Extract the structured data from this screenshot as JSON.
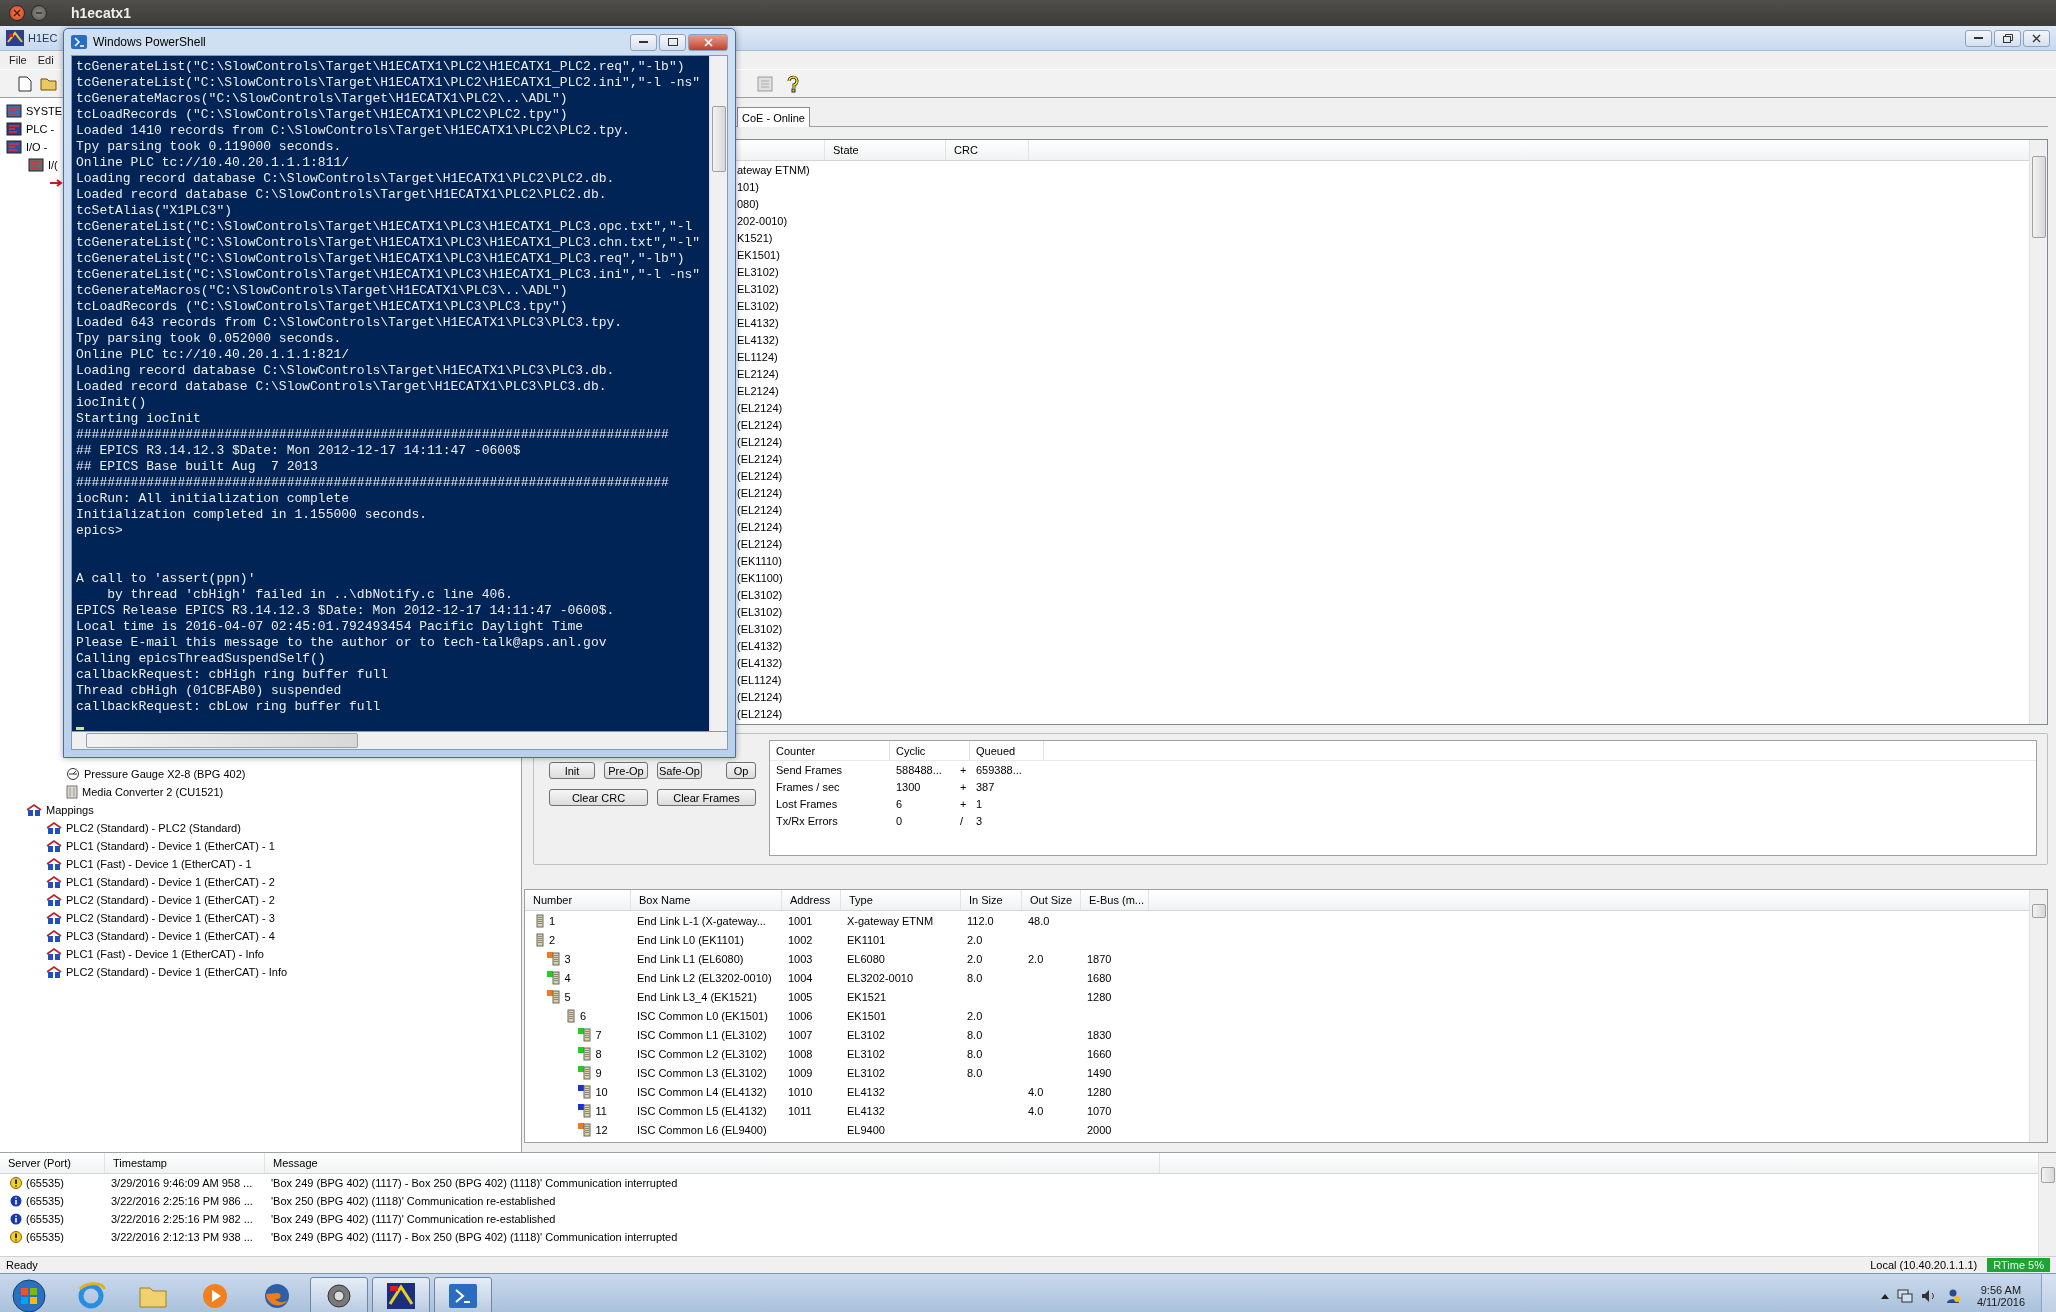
{
  "desktop_title": "h1ecatx1",
  "app": {
    "title": "H1EC",
    "menu": [
      "File",
      "Edi"
    ]
  },
  "tree_top": [
    {
      "label": "SYSTE",
      "kind": "system"
    },
    {
      "label": "PLC -",
      "kind": "plc"
    },
    {
      "label": "I/O -",
      "kind": "io",
      "children": [
        {
          "label": "I/(",
          "kind": "device"
        }
      ]
    }
  ],
  "tree_devices": [
    {
      "label": "Pressure Gauge X2-8 (BPG 402)",
      "kind": "gauge"
    },
    {
      "label": "Media Converter 2 (CU1521)",
      "kind": "terminal"
    }
  ],
  "mappings": {
    "label": "Mappings",
    "children": [
      {
        "label": "PLC2 (Standard) - PLC2 (Standard)"
      },
      {
        "label": "PLC1 (Standard) - Device 1 (EtherCAT) - 1"
      },
      {
        "label": "PLC1 (Fast) - Device 1 (EtherCAT) - 1"
      },
      {
        "label": "PLC1 (Standard) - Device 1 (EtherCAT) - 2"
      },
      {
        "label": "PLC2 (Standard) - Device 1 (EtherCAT) - 2"
      },
      {
        "label": "PLC2 (Standard) - Device 1 (EtherCAT) - 3"
      },
      {
        "label": "PLC3 (Standard) - Device 1 (EtherCAT) - 4"
      },
      {
        "label": "PLC1 (Fast) - Device 1 (EtherCAT) - Info"
      },
      {
        "label": "PLC2 (Standard) - Device 1 (EtherCAT) - Info"
      }
    ]
  },
  "tabs": [
    {
      "label": "CoE - Online",
      "selected": true
    }
  ],
  "device_list": {
    "columns": [
      "State",
      "CRC"
    ],
    "rows": [
      "ateway ETNM)",
      "101)",
      "080)",
      "202-0010)",
      "K1521)",
      "EK1501)",
      "EL3102)",
      "EL3102)",
      "EL3102)",
      "EL4132)",
      "EL4132)",
      "EL1124)",
      "EL2124)",
      "EL2124)",
      "(EL2124)",
      "(EL2124)",
      "(EL2124)",
      "(EL2124)",
      "(EL2124)",
      "(EL2124)",
      "(EL2124)",
      "(EL2124)",
      "(EL2124)",
      "(EK1110)",
      "(EK1100)",
      "(EL3102)",
      "(EL3102)",
      "(EL3102)",
      "(EL4132)",
      "(EL4132)",
      "(EL1124)",
      "(EL2124)",
      "(EL2124)"
    ]
  },
  "state_buttons": [
    "Init",
    "Pre-Op",
    "Safe-Op",
    "Op"
  ],
  "clear_buttons": [
    "Clear CRC",
    "Clear Frames"
  ],
  "counters": {
    "columns": [
      "Counter",
      "Cyclic",
      "Queued"
    ],
    "rows": [
      {
        "label": "Send Frames",
        "cyclic": "588488...",
        "op": "+",
        "queued": "659388..."
      },
      {
        "label": "Frames / sec",
        "cyclic": "1300",
        "op": "+",
        "queued": "387"
      },
      {
        "label": "Lost Frames",
        "cyclic": "6",
        "op": "+",
        "queued": "1"
      },
      {
        "label": "Tx/Rx Errors",
        "cyclic": "0",
        "op": "/",
        "queued": "3"
      }
    ]
  },
  "boxes": {
    "columns": [
      "Number",
      "Box Name",
      "Address",
      "Type",
      "In Size",
      "Out Size",
      "E-Bus (m..."
    ],
    "rows": [
      {
        "number": "1",
        "name": "End Link L-1 (X-gateway...",
        "address": "1001",
        "type": "X-gateway ETNM",
        "in_size": "112.0",
        "out_size": "48.0"
      },
      {
        "number": "2",
        "name": "End Link L0 (EK1101)",
        "address": "1002",
        "type": "EK1101",
        "in_size": "2.0",
        "children": [
          {
            "number": "3",
            "name": "End Link L1 (EL6080)",
            "address": "1003",
            "type": "EL6080",
            "in_size": "2.0",
            "out_size": "2.0",
            "ebus": "1870",
            "color": "#f07820"
          },
          {
            "number": "4",
            "name": "End Link L2 (EL3202-0010)",
            "address": "1004",
            "type": "EL3202-0010",
            "in_size": "8.0",
            "ebus": "1680",
            "color": "#20d020"
          },
          {
            "number": "5",
            "name": "End Link L3_4 (EK1521)",
            "address": "1005",
            "type": "EK1521",
            "ebus": "1280",
            "color": "#f07820",
            "children": [
              {
                "number": "6",
                "name": "ISC Common L0 (EK1501)",
                "address": "1006",
                "type": "EK1501",
                "in_size": "2.0",
                "children": [
                  {
                    "number": "7",
                    "name": "ISC Common L1 (EL3102)",
                    "address": "1007",
                    "type": "EL3102",
                    "in_size": "8.0",
                    "ebus": "1830",
                    "color": "#20d020"
                  },
                  {
                    "number": "8",
                    "name": "ISC Common L2 (EL3102)",
                    "address": "1008",
                    "type": "EL3102",
                    "in_size": "8.0",
                    "ebus": "1660",
                    "color": "#20d020"
                  },
                  {
                    "number": "9",
                    "name": "ISC Common L3 (EL3102)",
                    "address": "1009",
                    "type": "EL3102",
                    "in_size": "8.0",
                    "ebus": "1490",
                    "color": "#20d020"
                  },
                  {
                    "number": "10",
                    "name": "ISC Common L4 (EL4132)",
                    "address": "1010",
                    "type": "EL4132",
                    "out_size": "4.0",
                    "ebus": "1280",
                    "color": "#1830e0"
                  },
                  {
                    "number": "11",
                    "name": "ISC Common L5 (EL4132)",
                    "address": "1011",
                    "type": "EL4132",
                    "out_size": "4.0",
                    "ebus": "1070",
                    "color": "#1830e0"
                  },
                  {
                    "number": "12",
                    "name": "ISC Common L6 (EL9400)",
                    "type": "EL9400",
                    "ebus": "2000",
                    "color": "#f07820"
                  }
                ]
              }
            ]
          }
        ]
      }
    ]
  },
  "log": {
    "columns": [
      "Server (Port)",
      "Timestamp",
      "Message"
    ],
    "rows": [
      {
        "kind": "warning",
        "port": "(65535)",
        "time": "3/29/2016 9:46:09 AM 958 ...",
        "message": "'Box 249 (BPG 402) (1117) - Box 250 (BPG 402) (1118)' Communication interrupted"
      },
      {
        "kind": "info",
        "port": "(65535)",
        "time": "3/22/2016 2:25:16 PM 986 ...",
        "message": "'Box 250 (BPG 402) (1118)' Communication re-established"
      },
      {
        "kind": "info",
        "port": "(65535)",
        "time": "3/22/2016 2:25:16 PM 982 ...",
        "message": "'Box 249 (BPG 402) (1117)' Communication re-established"
      },
      {
        "kind": "warning",
        "port": "(65535)",
        "time": "3/22/2016 2:12:13 PM 938 ...",
        "message": "'Box 249 (BPG 402) (1117) - Box 250 (BPG 402) (1118)' Communication interrupted"
      }
    ]
  },
  "status": {
    "text": "Ready",
    "connection": "Local (10.40.20.1.1.1)",
    "rtime": "RTime 5%"
  },
  "powershell": {
    "title": "Windows PowerShell",
    "blocks": [
      {
        "lines": [
          "tcGenerateList(\"C:\\SlowControls\\Target\\H1ECATX1\\PLC2\\H1ECATX1_PLC2.req\",\"-lb\")",
          "tcGenerateList(\"C:\\SlowControls\\Target\\H1ECATX1\\PLC2\\H1ECATX1_PLC2.ini\",\"-l -ns\"",
          "tcGenerateMacros(\"C:\\SlowControls\\Target\\H1ECATX1\\PLC2\\..\\ADL\")",
          "tcLoadRecords (\"C:\\SlowControls\\Target\\H1ECATX1\\PLC2\\PLC2.tpy\")",
          "Loaded 1410 records from C:\\SlowControls\\Target\\H1ECATX1\\PLC2\\PLC2.tpy.",
          "Tpy parsing took 0.119000 seconds.",
          "Online PLC tc://10.40.20.1.1.1:811/",
          "Loading record database C:\\SlowControls\\Target\\H1ECATX1\\PLC2\\PLC2.db.",
          "Loaded record database C:\\SlowControls\\Target\\H1ECATX1\\PLC2\\PLC2.db.",
          "tcSetAlias(\"X1PLC3\")",
          "tcGenerateList(\"C:\\SlowControls\\Target\\H1ECATX1\\PLC3\\H1ECATX1_PLC3.opc.txt\",\"-l",
          "tcGenerateList(\"C:\\SlowControls\\Target\\H1ECATX1\\PLC3\\H1ECATX1_PLC3.chn.txt\",\"-l\"",
          "tcGenerateList(\"C:\\SlowControls\\Target\\H1ECATX1\\PLC3\\H1ECATX1_PLC3.req\",\"-lb\")",
          "tcGenerateList(\"C:\\SlowControls\\Target\\H1ECATX1\\PLC3\\H1ECATX1_PLC3.ini\",\"-l -ns\"",
          "tcGenerateMacros(\"C:\\SlowControls\\Target\\H1ECATX1\\PLC3\\..\\ADL\")",
          "tcLoadRecords (\"C:\\SlowControls\\Target\\H1ECATX1\\PLC3\\PLC3.tpy\")",
          "Loaded 643 records from C:\\SlowControls\\Target\\H1ECATX1\\PLC3\\PLC3.tpy.",
          "Tpy parsing took 0.052000 seconds.",
          "Online PLC tc://10.40.20.1.1.1:821/",
          "Loading record database C:\\SlowControls\\Target\\H1ECATX1\\PLC3\\PLC3.db.",
          "Loaded record database C:\\SlowControls\\Target\\H1ECATX1\\PLC3\\PLC3.db.",
          "iocInit()",
          "Starting iocInit",
          "############################################################################",
          "## EPICS R3.14.12.3 $Date: Mon 2012-12-17 14:11:47 -0600$",
          "## EPICS Base built Aug  7 2013",
          "############################################################################",
          "iocRun: All initialization complete",
          "Initialization completed in 1.155000 seconds.",
          "epics>"
        ]
      },
      {
        "lines": [
          "A call to 'assert(ppn)'",
          "    by thread 'cbHigh' failed in ..\\dbNotify.c line 406.",
          "EPICS Release EPICS R3.14.12.3 $Date: Mon 2012-12-17 14:11:47 -0600$.",
          "Local time is 2016-04-07 02:45:01.792493454 Pacific Daylight Time",
          "Please E-mail this message to the author or to tech-talk@aps.anl.gov",
          "Calling epicsThreadSuspendSelf()",
          "callbackRequest: cbHigh ring buffer full",
          "Thread cbHigh (01CBFAB0) suspended",
          "callbackRequest: cbLow ring buffer full"
        ]
      }
    ]
  },
  "taskbar": {
    "time": "9:56 AM",
    "date": "4/11/2016"
  }
}
